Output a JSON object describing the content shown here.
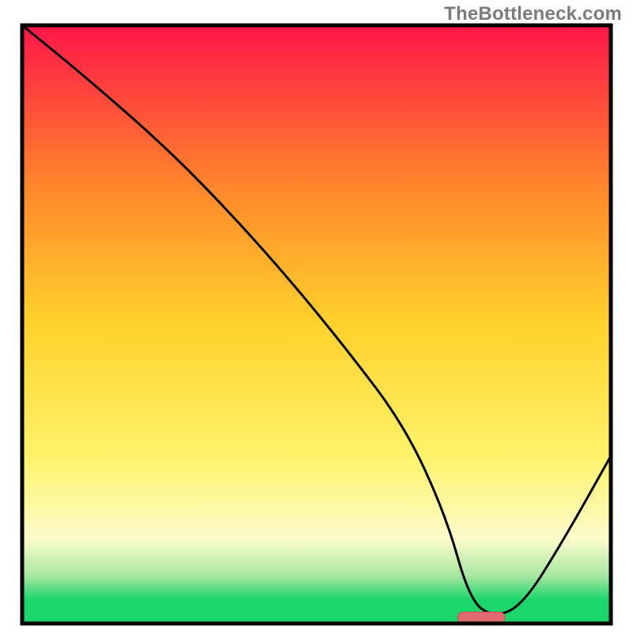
{
  "attribution": "TheBottleneck.com",
  "colors": {
    "frame": "#000000",
    "curve": "#000000",
    "attribution_text": "#7c7b7a",
    "gradient_top": "#ff1648",
    "gradient_mid_upper": "#ff8a2a",
    "gradient_mid": "#ffd22c",
    "gradient_mid_lower": "#fff36a",
    "gradient_pale": "#fbfccb",
    "gradient_green_light": "#a9e7a2",
    "gradient_green": "#1bd66a",
    "marker_fill": "#e06a6f",
    "marker_stroke": "#c94f55"
  },
  "chart_data": {
    "type": "line",
    "title": "",
    "xlabel": "",
    "ylabel": "",
    "xlim": [
      0,
      100
    ],
    "ylim": [
      0,
      100
    ],
    "grid": false,
    "legend": false,
    "description": "Bottleneck percentage curve over a red-to-green vertical gradient. High values (bottleneck) appear toward the top/left, zero bottleneck near x≈78.",
    "series": [
      {
        "name": "bottleneck-curve",
        "x": [
          0,
          10,
          24,
          35,
          45,
          55,
          65,
          72,
          76,
          80,
          85,
          92,
          100
        ],
        "y": [
          100,
          92,
          80,
          69,
          58,
          46,
          33,
          18,
          4,
          1,
          3,
          14,
          28
        ]
      }
    ],
    "marker": {
      "name": "optimal-range",
      "x_center": 78,
      "x_half_width": 4,
      "y": 1
    },
    "gradient_stops_pct": [
      0,
      28,
      50,
      72,
      86,
      92,
      96,
      100
    ]
  }
}
